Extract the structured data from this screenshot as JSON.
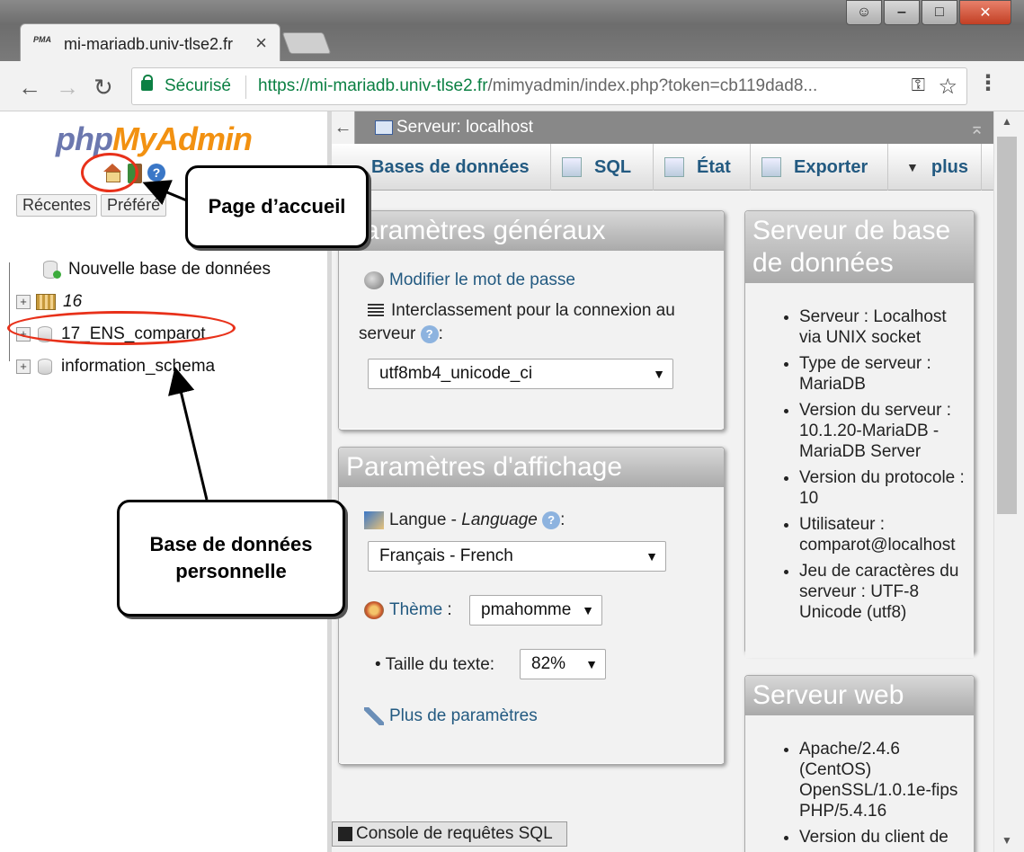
{
  "browser": {
    "tab_title": "mi-mariadb.univ-tlse2.fr",
    "tab_favicon": "PMA",
    "secure_label": "Sécurisé",
    "url_scheme": "https://",
    "url_host": "mi-mariadb.univ-tlse2.fr",
    "url_path": "/mimyadmin/index.php?token=cb119dad8..."
  },
  "logo": {
    "php": "php",
    "my": "My",
    "admin": "Admin"
  },
  "left_tabs": [
    "Récentes",
    "Préféré"
  ],
  "tree": {
    "new_db": "Nouvelle base de données",
    "items": [
      "16",
      "17_ENS_comparot",
      "information_schema"
    ]
  },
  "server_bar": {
    "label": "Serveur: localhost"
  },
  "top_menu": [
    "Bases de données",
    "SQL",
    "État",
    "Exporter",
    "plus"
  ],
  "general": {
    "title": "Paramètres généraux",
    "change_password": "Modifier le mot de passe",
    "collation_label": "Interclassement pour la connexion au serveur",
    "collation_value": "utf8mb4_unicode_ci"
  },
  "display": {
    "title": "Paramètres d'affichage",
    "language_label": "Langue - ",
    "language_label_en": "Language",
    "language_value": "Français - French",
    "theme_label": "Thème",
    "theme_value": "pmahomme",
    "font_size_label": "Taille du texte:",
    "font_size_value": "82%",
    "more_settings": "Plus de paramètres"
  },
  "db_server": {
    "title": "Serveur de base de données",
    "items": [
      "Serveur : Localhost via UNIX socket",
      "Type de serveur : MariaDB",
      "Version du serveur : 10.1.20-MariaDB - MariaDB Server",
      "Version du protocole : 10",
      "Utilisateur : comparot@localhost",
      "Jeu de caractères du serveur : UTF-8 Unicode (utf8)"
    ]
  },
  "web_server": {
    "title": "Serveur web",
    "items": [
      "Apache/2.4.6 (CentOS) OpenSSL/1.0.1e-fips PHP/5.4.16",
      "Version du client de"
    ]
  },
  "console": {
    "label": "Console de requêtes SQL"
  },
  "annotations": {
    "home": "Page d’accueil",
    "personal_db_line1": "Base de données",
    "personal_db_line2": "personnelle"
  }
}
